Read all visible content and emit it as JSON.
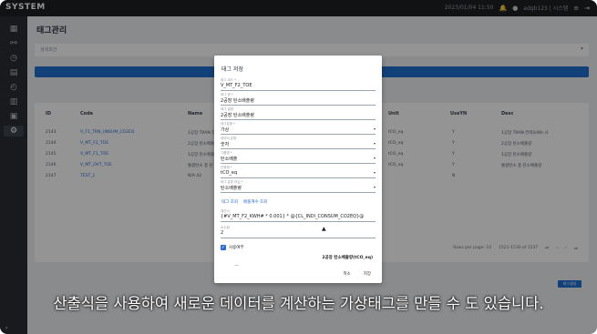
{
  "app": {
    "brand": "SYSTEM"
  },
  "topbar": {
    "datetime": "2023/01/04 11:50",
    "user": "adqb123 | 시스템",
    "badge_color": "#e53935"
  },
  "page": {
    "title": "태그관리"
  },
  "search": {
    "placeholder": "검색조건"
  },
  "table": {
    "headers": [
      "ID",
      "Code",
      "Name",
      "Unit",
      "UseYN",
      "Desc"
    ],
    "rows": [
      {
        "id": "2143",
        "code": "V_F1_TRN_UNSUM_CO2EQ",
        "name": "1공장 TRAN 전",
        "unit": "tCO_eq",
        "use": "Y",
        "desc": "1공장 TRAN 전력(kWh 사"
      },
      {
        "id": "2144",
        "code": "V_MT_F2_TOE",
        "name": "2공장 탄소배출",
        "unit": "tCO_eq",
        "use": "Y",
        "desc": "2공장 탄소배출량"
      },
      {
        "id": "2145",
        "code": "V_MT_F1_TOE",
        "name": "1공장 탄소배출",
        "unit": "tCO_eq",
        "use": "Y",
        "desc": "1공장 탄소배출량"
      },
      {
        "id": "2146",
        "code": "V_MT_OVT_TOE",
        "name": "통합탄소 총 탄",
        "unit": "tCO_eq",
        "use": "Y",
        "desc": "통합탄소 총 탄소배출량"
      },
      {
        "id": "2147",
        "code": "TEST_1",
        "name": "N/A 42",
        "unit": "",
        "use": "N",
        "desc": ""
      }
    ],
    "pager": {
      "rows_per_page": "Rows per page: 10",
      "range": "1521-1530 of 1537"
    }
  },
  "side_button": "태그생성",
  "modal": {
    "title": "태그 저장",
    "fields": [
      {
        "label": "태그 코드 *",
        "value": "V_MT_F2_TOE",
        "select": false
      },
      {
        "label": "태그 명 *",
        "value": "2공장 탄소배출량",
        "select": false
      },
      {
        "label": "태그 설명",
        "value": "2공장 탄소배출량",
        "select": false
      },
      {
        "label": "태그유형 *",
        "value": "가상",
        "select": true
      },
      {
        "label": "데이터 유형",
        "value": "숫자",
        "select": true
      },
      {
        "label": "그룹명 *",
        "value": "탄소배출",
        "select": true
      },
      {
        "label": "단위명 *",
        "value": "tCO_eq",
        "select": true
      },
      {
        "label": "태그 분류 타입 *",
        "value": "탄소배출량",
        "select": true
      }
    ],
    "tabs": [
      "태그 조회",
      "배출계수 조회"
    ],
    "formula": {
      "label": "계산식",
      "value": "{#V_MT_F2_KWH# * 0.001} * @{CL_INDI_CONSUM_CO2EQ}@"
    },
    "decimal": {
      "label": "소수점",
      "value": "2"
    },
    "use_label": "사용여부",
    "summary": "2공장 탄소배출량(tCO_eq)",
    "cancel": "취소",
    "save": "저장"
  },
  "subtitle": "산출식을 사용하여 새로운 데이터를 계산하는 가상태그를 만들 수 도 있습니다.",
  "colors": {
    "primary": "#1f6fd1",
    "topbar": "#1d1f24",
    "sidebar": "#2a2d33"
  }
}
